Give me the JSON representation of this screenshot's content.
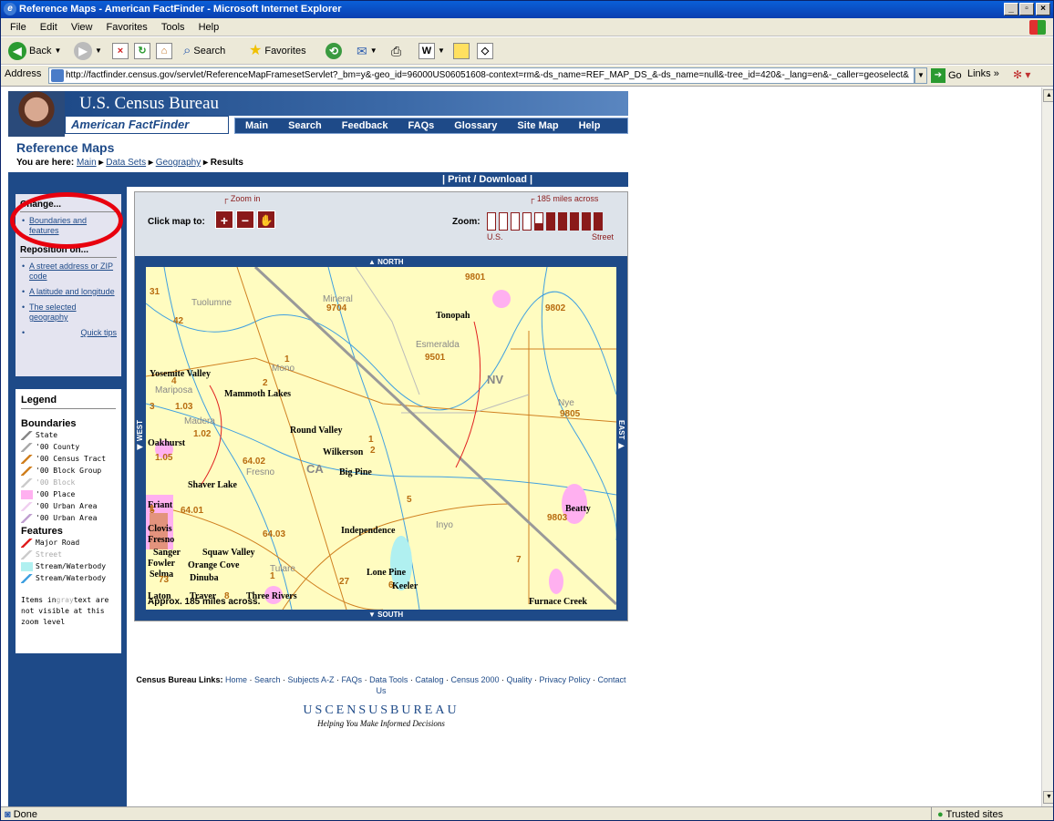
{
  "window": {
    "title": "Reference Maps - American FactFinder - Microsoft Internet Explorer"
  },
  "menu": [
    "File",
    "Edit",
    "View",
    "Favorites",
    "Tools",
    "Help"
  ],
  "toolbar": {
    "back": "Back",
    "search": "Search",
    "favorites": "Favorites"
  },
  "address": {
    "label": "Address",
    "url": "http://factfinder.census.gov/servlet/ReferenceMapFramesetServlet?_bm=y&-geo_id=96000US06051608-context=rm&-ds_name=REF_MAP_DS_&-ds_name=null&-tree_id=420&-_lang=en&-_caller=geoselect&",
    "go": "Go",
    "links": "Links"
  },
  "header": {
    "agency": "U.S. Census Bureau",
    "product": "American FactFinder",
    "nav": [
      "Main",
      "Search",
      "Feedback",
      "FAQs",
      "Glossary",
      "Site Map",
      "Help"
    ]
  },
  "page": {
    "title": "Reference Maps",
    "crumb_prefix": "You are here:",
    "crumbs": [
      "Main",
      "Data Sets",
      "Geography"
    ],
    "crumb_current": "Results",
    "print": "| Print / Download |"
  },
  "change": {
    "header": "Change...",
    "boundaries": "Boundaries and features",
    "reposition": "Reposition on...",
    "street": "A street address or ZIP code",
    "latlon": "A latitude and longitude",
    "selected": "The selected geography",
    "quicktips": "Quick tips"
  },
  "legend": {
    "title": "Legend",
    "boundaries": "Boundaries",
    "items": [
      {
        "label": "State",
        "color": "#888888",
        "gray": false
      },
      {
        "label": "'00 County",
        "color": "#aaaaaa",
        "gray": false
      },
      {
        "label": "'00 Census Tract",
        "color": "#d08020",
        "gray": false
      },
      {
        "label": "'00 Block Group",
        "color": "#d08020",
        "gray": false
      },
      {
        "label": "'00 Block",
        "color": "#cccccc",
        "gray": true
      },
      {
        "label": "'00 Place",
        "color": "#ffb0f0",
        "gray": false
      },
      {
        "label": "'00 Urban Area",
        "color": "#f0d0f0",
        "gray": false
      },
      {
        "label": "'00 Urban Area",
        "color": "#c0a0d0",
        "gray": false
      }
    ],
    "features": "Features",
    "feature_items": [
      {
        "label": "Major Road",
        "color": "#e02020",
        "gray": false
      },
      {
        "label": "Street",
        "color": "#cccccc",
        "gray": true
      },
      {
        "label": "Stream/Waterbody",
        "color": "#b0f0f0",
        "gray": false
      },
      {
        "label": "Stream/Waterbody",
        "color": "#40a0e0",
        "gray": false
      }
    ],
    "note_pre": "Items in",
    "note_gray": "gray",
    "note_post": "text are not visible at this zoom level"
  },
  "mapctl": {
    "click": "Click map to:",
    "zoomin": "Zoom in",
    "across_top": "185 miles across",
    "zoom": "Zoom:",
    "us": "U.S.",
    "street": "Street",
    "zoom_level": 5,
    "zoom_levels": 10
  },
  "compass": {
    "north": "NORTH",
    "south": "SOUTH",
    "west": "WEST",
    "east": "EAST"
  },
  "map": {
    "places": [
      "Tonopah",
      "Yosemite Valley",
      "Mammoth Lakes",
      "Round Valley",
      "Wilkerson",
      "Big Pine",
      "Oakhurst",
      "Shaver Lake",
      "Friant",
      "Clovis",
      "Fresno",
      "Independence",
      "Sanger",
      "Squaw Valley",
      "Fowler",
      "Orange Cove",
      "Selma",
      "Dinuba",
      "Lone Pine",
      "Keeler",
      "Laton",
      "Traver",
      "Three Rivers",
      "Beatty",
      "Furnace Creek"
    ],
    "nums": [
      "9801",
      "31",
      "9704",
      "9802",
      "42",
      "9501",
      "1",
      "4",
      "2",
      "3",
      "1.03",
      "1.02",
      "1",
      "2",
      "1.05",
      "64.02",
      "5",
      "1",
      "9805",
      "5",
      "64.01",
      "64.03",
      "9803",
      "7",
      "73",
      "8",
      "1",
      "27",
      "6"
    ],
    "grays": [
      "Mineral",
      "Tuolumne",
      "Esmeralda",
      "Mono",
      "Mariposa",
      "Madera",
      "Nye",
      "Fresno",
      "Inyo",
      "Tulare"
    ],
    "states": [
      "NV",
      "CA"
    ],
    "scale": "Approx. 185 miles across."
  },
  "footer": {
    "label": "Census Bureau Links:",
    "links": [
      "Home",
      "Search",
      "Subjects A-Z",
      "FAQs",
      "Data Tools",
      "Catalog",
      "Census 2000",
      "Quality",
      "Privacy Policy",
      "Contact Us"
    ],
    "brand": "USCENSUSBUREAU",
    "tagline": "Helping You Make Informed Decisions"
  },
  "status": {
    "left": "Done",
    "right": "Trusted sites"
  }
}
